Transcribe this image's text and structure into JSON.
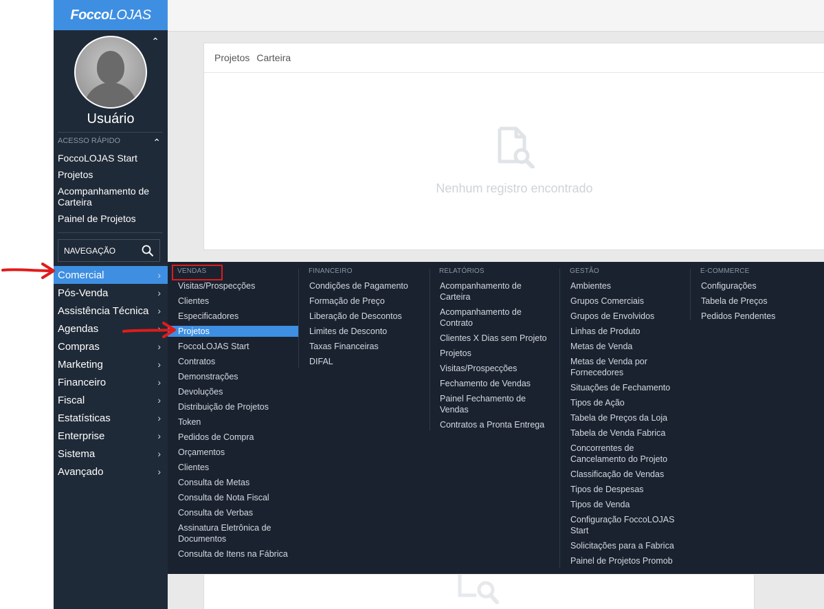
{
  "sidebar": {
    "logo_bold": "Focco",
    "logo_light": "LOJAS",
    "username": "Usuário",
    "quick_access_title": "ACESSO RÁPIDO",
    "quick_items": [
      {
        "label": "FoccoLOJAS Start"
      },
      {
        "label": "Projetos"
      },
      {
        "label": "Acompanhamento de Carteira"
      },
      {
        "label": "Painel de Projetos"
      }
    ],
    "nav_search_label": "NAVEGAÇÃO",
    "menu": [
      {
        "label": "Comercial",
        "active": true
      },
      {
        "label": "Pós-Venda"
      },
      {
        "label": "Assistência Técnica"
      },
      {
        "label": "Agendas"
      },
      {
        "label": "Compras"
      },
      {
        "label": "Marketing"
      },
      {
        "label": "Financeiro"
      },
      {
        "label": "Fiscal"
      },
      {
        "label": "Estatísticas"
      },
      {
        "label": "Enterprise"
      },
      {
        "label": "Sistema"
      },
      {
        "label": "Avançado"
      }
    ]
  },
  "card": {
    "tab1": "Projetos",
    "tab2": "Carteira",
    "empty_text": "Nenhum registro encontrado"
  },
  "mega_menu": {
    "vendas": {
      "title": "VENDAS",
      "items": [
        "Visitas/Prospecções",
        "Clientes",
        "Especificadores",
        "Projetos",
        "FoccoLOJAS Start",
        "Contratos",
        "Demonstrações",
        "Devoluções",
        "Distribuição de Projetos",
        "Token",
        "Pedidos de Compra",
        "Orçamentos",
        "Clientes",
        "Consulta de Metas",
        "Consulta de Nota Fiscal",
        "Consulta de Verbas",
        "Assinatura Eletrônica de Documentos",
        "Consulta de Itens na Fábrica"
      ]
    },
    "financeiro": {
      "title": "FINANCEIRO",
      "items": [
        "Condições de Pagamento",
        "Formação de Preço",
        "Liberação de Descontos",
        "Limites de Desconto",
        "Taxas Financeiras",
        "DIFAL"
      ]
    },
    "relatorios": {
      "title": "RELATÓRIOS",
      "items": [
        "Acompanhamento de Carteira",
        "Acompanhamento de Contrato",
        "Clientes X Dias sem Projeto",
        "Projetos",
        "Visitas/Prospecções",
        "Fechamento de Vendas",
        "Painel Fechamento de Vendas",
        "Contratos a Pronta Entrega"
      ]
    },
    "gestao": {
      "title": "GESTÃO",
      "items": [
        "Ambientes",
        "Grupos Comerciais",
        "Grupos de Envolvidos",
        "Linhas de Produto",
        "Metas de Venda",
        "Metas de Venda por Fornecedores",
        "Situações de Fechamento",
        "Tipos de Ação",
        "Tabela de Preços da Loja",
        "Tabela de Venda Fabrica",
        "Concorrentes de Cancelamento do Projeto",
        "Classificação de Vendas",
        "Tipos de Despesas",
        "Tipos de Venda",
        "Configuração FoccoLOJAS Start",
        "Solicitações para a Fabrica",
        "Painel de Projetos Promob"
      ]
    },
    "ecommerce": {
      "title": "E-COMMERCE",
      "items": [
        "Configurações",
        "Tabela de Preços",
        "Pedidos Pendentes"
      ]
    }
  },
  "colors": {
    "sidebar_bg": "#1f2a38",
    "accent": "#3e8fe2",
    "annotation": "#e01b1b"
  }
}
